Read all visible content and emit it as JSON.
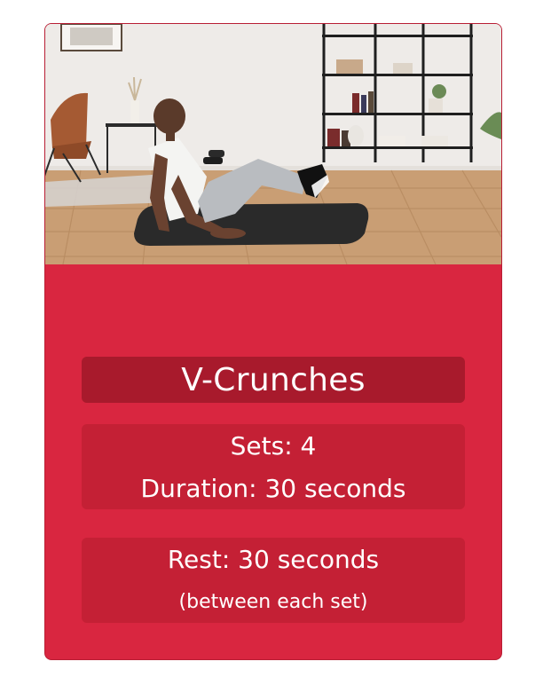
{
  "exercise": {
    "image_description": "person-doing-v-crunch-on-mat",
    "title": "V-Crunches",
    "sets_text": "Sets: 4",
    "duration_text": "Duration: 30 seconds",
    "rest_text": "Rest: 30 seconds",
    "rest_note": "(between each set)"
  },
  "colors": {
    "card": "#d92640",
    "title_box": "#a81a2c",
    "info_box": "#c42035",
    "text": "#ffffff"
  }
}
